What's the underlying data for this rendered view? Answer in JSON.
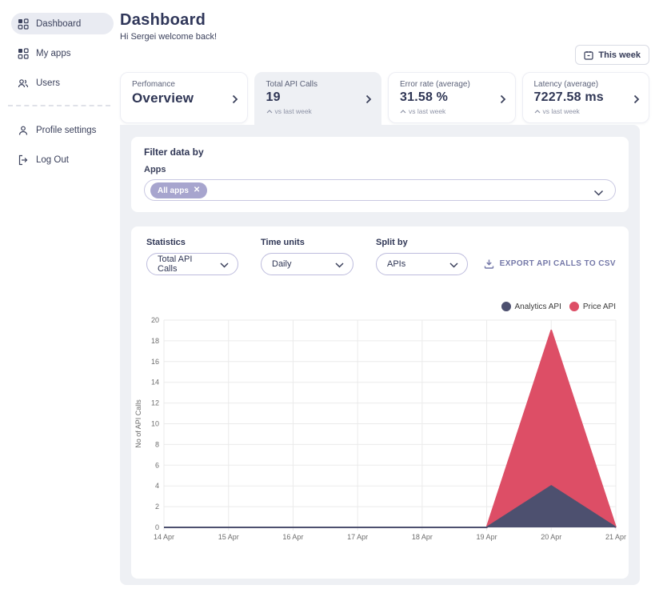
{
  "sidebar": {
    "items": [
      {
        "label": "Dashboard",
        "icon": "grid-icon",
        "active": true
      },
      {
        "label": "My apps",
        "icon": "grid-icon",
        "active": false
      },
      {
        "label": "Users",
        "icon": "users-icon",
        "active": false
      },
      {
        "label": "Profile settings",
        "icon": "person-icon",
        "active": false
      },
      {
        "label": "Log Out",
        "icon": "logout-icon",
        "active": false
      }
    ]
  },
  "header": {
    "title": "Dashboard",
    "subtitle": "Hi Sergei welcome back!",
    "period_button": "This week"
  },
  "tabs": [
    {
      "label": "Perfomance",
      "value": "Overview",
      "sub": "",
      "active": false
    },
    {
      "label": "Total API Calls",
      "value": "19",
      "sub": "vs last week",
      "active": true
    },
    {
      "label": "Error rate (average)",
      "value": "31.58 %",
      "sub": "vs last week",
      "active": false
    },
    {
      "label": "Latency (average)",
      "value": "7227.58 ms",
      "sub": "vs last week",
      "active": false
    }
  ],
  "filter": {
    "title": "Filter data by",
    "apps_label": "Apps",
    "chip_label": "All apps"
  },
  "controls": {
    "statistics": {
      "label": "Statistics",
      "value": "Total API Calls"
    },
    "time_units": {
      "label": "Time units",
      "value": "Daily"
    },
    "split_by": {
      "label": "Split by",
      "value": "APIs"
    },
    "export_label": "EXPORT API CALLS TO CSV"
  },
  "chart_data": {
    "type": "area",
    "stacked": true,
    "x": [
      "14 Apr",
      "15 Apr",
      "16 Apr",
      "17 Apr",
      "18 Apr",
      "19 Apr",
      "20 Apr",
      "21 Apr"
    ],
    "series": [
      {
        "name": "Analytics API",
        "color": "#4d506f",
        "values": [
          0,
          0,
          0,
          0,
          0,
          0,
          4,
          0
        ]
      },
      {
        "name": "Price API",
        "color": "#dd4e66",
        "values": [
          0,
          0,
          0,
          0,
          0,
          0,
          15,
          0
        ]
      }
    ],
    "title": "",
    "xlabel": "",
    "ylabel": "No of API Calls",
    "ylim": [
      0,
      20
    ],
    "ytick_step": 2,
    "grid": true,
    "legend_position": "top-right"
  },
  "colors": {
    "panel_bg": "#eef0f4",
    "chip_bg": "#a7a5ce",
    "export_text": "#7478a8",
    "text_dark": "#2f3655"
  }
}
